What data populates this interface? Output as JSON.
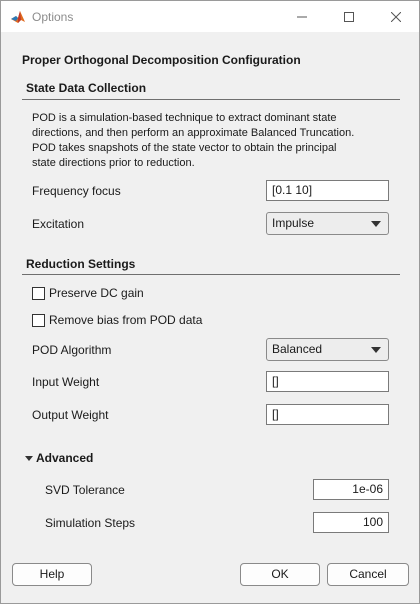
{
  "window": {
    "title": "Options",
    "controls": {
      "minimize": "—",
      "maximize": "☐",
      "close": "✕"
    }
  },
  "heading": "Proper Orthogonal Decomposition Configuration",
  "state_data_collection": {
    "title": "State Data Collection",
    "description_lines": [
      "POD is a simulation-based technique to extract dominant state",
      "directions, and then perform an approximate Balanced Truncation.",
      "POD takes snapshots of the state vector to obtain the principal",
      "state directions prior to reduction."
    ],
    "frequency_focus": {
      "label": "Frequency focus",
      "value": "[0.1 10]"
    },
    "excitation": {
      "label": "Excitation",
      "value": "Impulse"
    }
  },
  "reduction_settings": {
    "title": "Reduction Settings",
    "preserve_dc_gain": {
      "label": "Preserve DC gain",
      "checked": false
    },
    "remove_bias": {
      "label": "Remove bias from POD data",
      "checked": false
    },
    "pod_algorithm": {
      "label": "POD Algorithm",
      "value": "Balanced"
    },
    "input_weight": {
      "label": "Input Weight",
      "value": "[]"
    },
    "output_weight": {
      "label": "Output Weight",
      "value": "[]"
    }
  },
  "advanced": {
    "label": "Advanced",
    "expanded": true,
    "svd_tolerance": {
      "label": "SVD Tolerance",
      "value": "1e-06"
    },
    "simulation_steps": {
      "label": "Simulation Steps",
      "value": "100"
    }
  },
  "buttons": {
    "help": "Help",
    "ok": "OK",
    "cancel": "Cancel"
  }
}
